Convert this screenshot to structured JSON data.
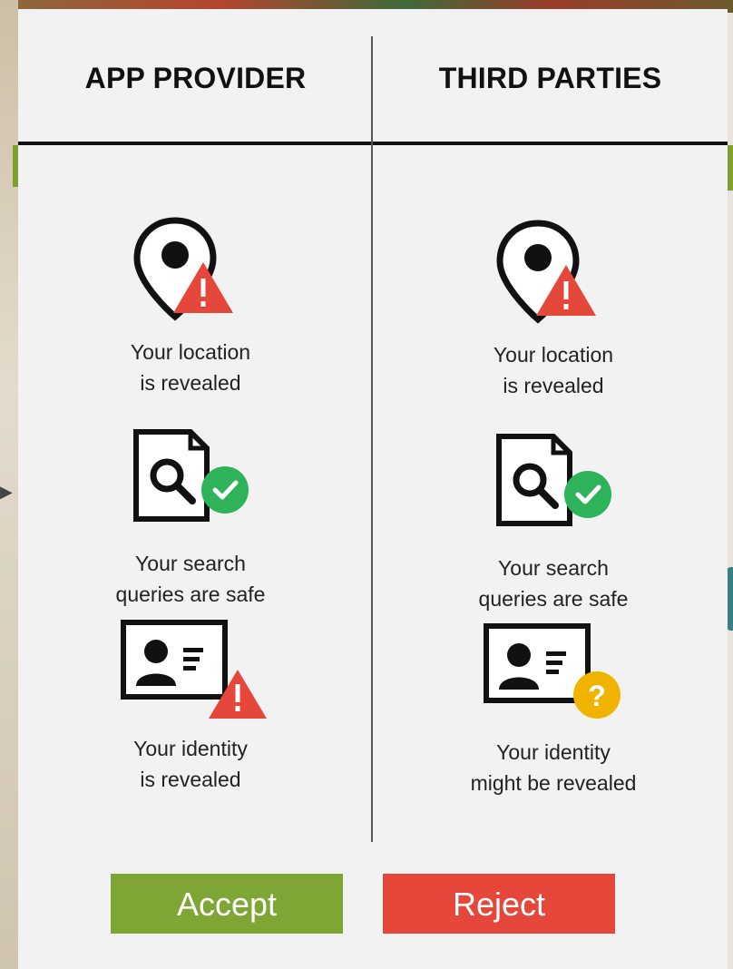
{
  "columns": {
    "left": {
      "title": "APP PROVIDER",
      "location": {
        "line1": "Your location",
        "line2": "is revealed",
        "status_icon": "warning-icon"
      },
      "search": {
        "line1": "Your search",
        "line2": "queries are safe",
        "status_icon": "check-icon"
      },
      "identity": {
        "line1": "Your identity",
        "line2": "is revealed",
        "status_icon": "warning-icon"
      }
    },
    "right": {
      "title": "THIRD PARTIES",
      "location": {
        "line1": "Your location",
        "line2": "is revealed",
        "status_icon": "warning-icon"
      },
      "search": {
        "line1": "Your search",
        "line2": "queries are safe",
        "status_icon": "check-icon"
      },
      "identity": {
        "line1": "Your identity",
        "line2": "might be revealed",
        "status_icon": "question-icon"
      }
    }
  },
  "buttons": {
    "accept": "Accept",
    "reject": "Reject"
  },
  "colors": {
    "accept": "#7fa634",
    "reject": "#e5473b",
    "warning": "#e5473b",
    "safe": "#2fb35a",
    "unknown": "#f0b400"
  }
}
